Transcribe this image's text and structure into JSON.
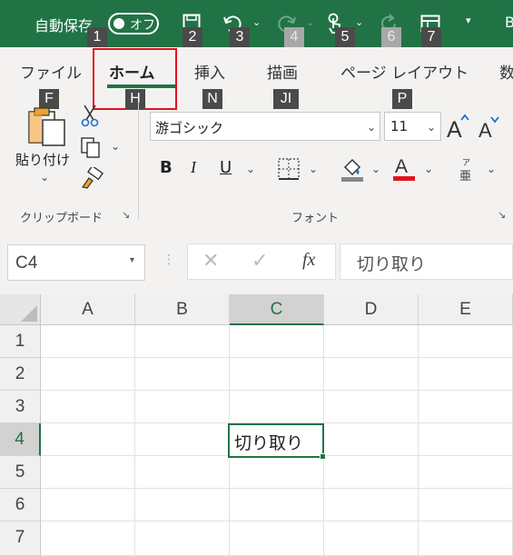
{
  "title_bar": {
    "autosave_label": "自動保存",
    "autosave_toggle": "オフ",
    "qat_keytips": [
      "1",
      "2",
      "3",
      "4",
      "5",
      "6",
      "7"
    ],
    "account_initial": "B"
  },
  "ribbon": {
    "tabs": [
      {
        "label": "ファイル",
        "keytip": "F"
      },
      {
        "label": "ホーム",
        "keytip": "H"
      },
      {
        "label": "挿入",
        "keytip": "N"
      },
      {
        "label": "描画",
        "keytip": "JI"
      },
      {
        "label": "ページ レイアウト",
        "keytip": "P"
      },
      {
        "label": "数"
      }
    ],
    "clipboard": {
      "paste_label": "貼り付け",
      "group_label": "クリップボード"
    },
    "font": {
      "font_name": "游ゴシック",
      "font_size": "11",
      "bold": "B",
      "italic": "I",
      "underline": "U",
      "font_color_glyph": "A",
      "phonetic_glyph": "亜",
      "phonetic_ruby": "ア",
      "group_label": "フォント"
    }
  },
  "formula_bar": {
    "name_box": "C4",
    "fx_label": "fx",
    "content": "切り取り"
  },
  "sheet": {
    "columns": [
      "A",
      "B",
      "C",
      "D",
      "E"
    ],
    "rows": [
      "1",
      "2",
      "3",
      "4",
      "5",
      "6",
      "7"
    ],
    "active_cell_ref": "C4",
    "active_cell_value": "切り取り"
  },
  "colors": {
    "brand": "#217346",
    "highlight_border": "#e1121f",
    "font_color_bar": "#e1121f"
  }
}
